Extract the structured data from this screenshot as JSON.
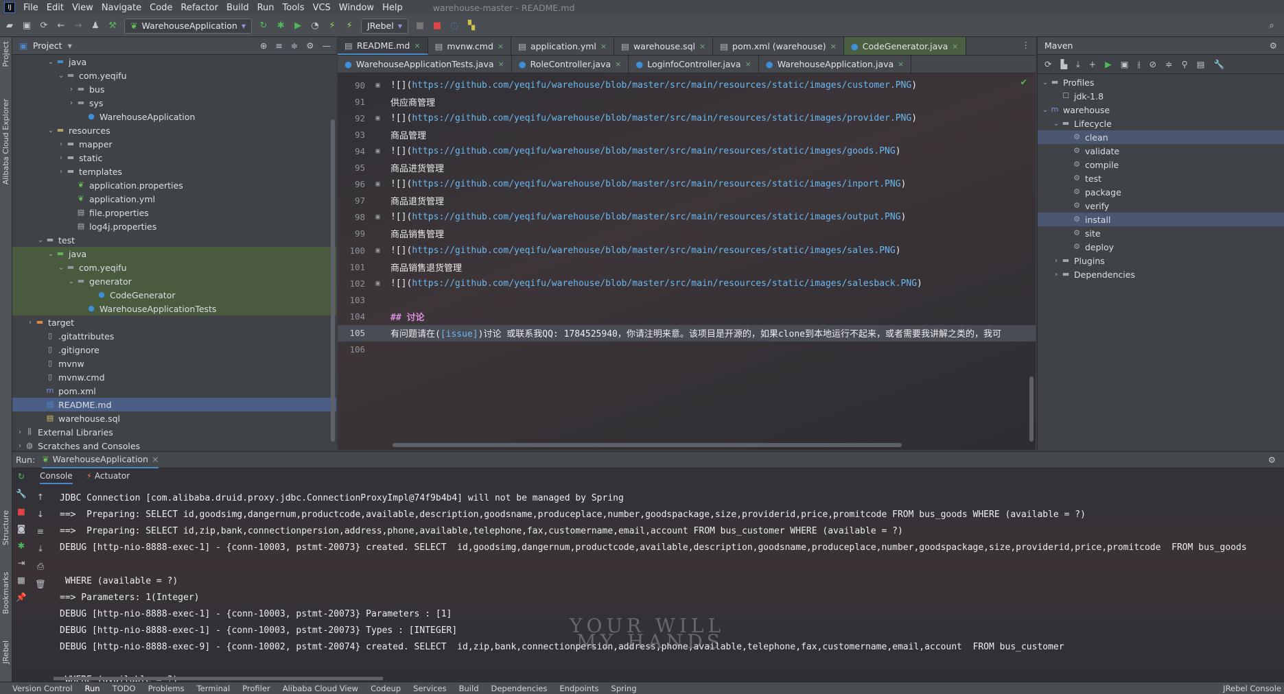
{
  "window": {
    "title": "warehouse-master - README.md"
  },
  "menu": [
    "File",
    "Edit",
    "View",
    "Navigate",
    "Code",
    "Refactor",
    "Build",
    "Run",
    "Tools",
    "VCS",
    "Window",
    "Help"
  ],
  "toolbar": {
    "run_config": "WarehouseApplication",
    "jrebel": "JRebel"
  },
  "project": {
    "title": "Project",
    "tree": [
      {
        "label": "java",
        "indent": 3,
        "chev": "v",
        "icon": "folder-blue"
      },
      {
        "label": "com.yeqifu",
        "indent": 4,
        "chev": "v",
        "icon": "package"
      },
      {
        "label": "bus",
        "indent": 5,
        "chev": ">",
        "icon": "package"
      },
      {
        "label": "sys",
        "indent": 5,
        "chev": ">",
        "icon": "package"
      },
      {
        "label": "WarehouseApplication",
        "indent": 6,
        "chev": "",
        "icon": "class"
      },
      {
        "label": "resources",
        "indent": 3,
        "chev": "v",
        "icon": "folder-res"
      },
      {
        "label": "mapper",
        "indent": 4,
        "chev": ">",
        "icon": "folder"
      },
      {
        "label": "static",
        "indent": 4,
        "chev": ">",
        "icon": "folder"
      },
      {
        "label": "templates",
        "indent": 4,
        "chev": ">",
        "icon": "folder"
      },
      {
        "label": "application.properties",
        "indent": 5,
        "chev": "",
        "icon": "spring"
      },
      {
        "label": "application.yml",
        "indent": 5,
        "chev": "",
        "icon": "spring"
      },
      {
        "label": "file.properties",
        "indent": 5,
        "chev": "",
        "icon": "props"
      },
      {
        "label": "log4j.properties",
        "indent": 5,
        "chev": "",
        "icon": "props"
      },
      {
        "label": "test",
        "indent": 2,
        "chev": "v",
        "icon": "folder"
      },
      {
        "label": "java",
        "indent": 3,
        "chev": "v",
        "icon": "folder-green"
      },
      {
        "label": "com.yeqifu",
        "indent": 4,
        "chev": "v",
        "icon": "package"
      },
      {
        "label": "generator",
        "indent": 5,
        "chev": "v",
        "icon": "package"
      },
      {
        "label": "CodeGenerator",
        "indent": 7,
        "chev": "",
        "icon": "class"
      },
      {
        "label": "WarehouseApplicationTests",
        "indent": 6,
        "chev": "",
        "icon": "class"
      },
      {
        "label": "target",
        "indent": 1,
        "chev": ">",
        "icon": "folder-orange"
      },
      {
        "label": ".gitattributes",
        "indent": 2,
        "chev": "",
        "icon": "file"
      },
      {
        "label": ".gitignore",
        "indent": 2,
        "chev": "",
        "icon": "file"
      },
      {
        "label": "mvnw",
        "indent": 2,
        "chev": "",
        "icon": "file"
      },
      {
        "label": "mvnw.cmd",
        "indent": 2,
        "chev": "",
        "icon": "file"
      },
      {
        "label": "pom.xml",
        "indent": 2,
        "chev": "",
        "icon": "maven"
      },
      {
        "label": "README.md",
        "indent": 2,
        "chev": "",
        "icon": "md"
      },
      {
        "label": "warehouse.sql",
        "indent": 2,
        "chev": "",
        "icon": "sql"
      },
      {
        "label": "External Libraries",
        "indent": 0,
        "chev": ">",
        "icon": "lib"
      },
      {
        "label": "Scratches and Consoles",
        "indent": 0,
        "chev": ">",
        "icon": "scratch"
      }
    ]
  },
  "editor": {
    "tabs_row1": [
      {
        "label": "README.md",
        "active": true
      },
      {
        "label": "mvnw.cmd"
      },
      {
        "label": "application.yml"
      },
      {
        "label": "warehouse.sql"
      },
      {
        "label": "pom.xml (warehouse)"
      },
      {
        "label": "CodeGenerator.java",
        "green": true
      }
    ],
    "tabs_row2": [
      {
        "label": "WarehouseApplicationTests.java"
      },
      {
        "label": "RoleController.java"
      },
      {
        "label": "LoginfoController.java"
      },
      {
        "label": "WarehouseApplication.java"
      }
    ],
    "lines": [
      {
        "n": "90",
        "pre": "![](",
        "link": "https://github.com/yeqifu/warehouse/blob/master/src/main/resources/static/images/customer.PNG",
        "post": ")"
      },
      {
        "n": "91",
        "text": "供应商管理"
      },
      {
        "n": "92",
        "pre": "![](",
        "link": "https://github.com/yeqifu/warehouse/blob/master/src/main/resources/static/images/provider.PNG",
        "post": ")"
      },
      {
        "n": "93",
        "text": "商品管理"
      },
      {
        "n": "94",
        "pre": "![](",
        "link": "https://github.com/yeqifu/warehouse/blob/master/src/main/resources/static/images/goods.PNG",
        "post": ")"
      },
      {
        "n": "95",
        "text": "商品进货管理"
      },
      {
        "n": "96",
        "pre": "![](",
        "link": "https://github.com/yeqifu/warehouse/blob/master/src/main/resources/static/images/inport.PNG",
        "post": ")"
      },
      {
        "n": "97",
        "text": "商品退货管理"
      },
      {
        "n": "98",
        "pre": "![](",
        "link": "https://github.com/yeqifu/warehouse/blob/master/src/main/resources/static/images/output.PNG",
        "post": ")"
      },
      {
        "n": "99",
        "text": "商品销售管理"
      },
      {
        "n": "100",
        "pre": "![](",
        "link": "https://github.com/yeqifu/warehouse/blob/master/src/main/resources/static/images/sales.PNG",
        "post": ")"
      },
      {
        "n": "101",
        "text": "商品销售退货管理"
      },
      {
        "n": "102",
        "pre": "![](",
        "link": "https://github.com/yeqifu/warehouse/blob/master/src/main/resources/static/images/salesback.PNG",
        "post": ")"
      },
      {
        "n": "103",
        "text": ""
      },
      {
        "n": "104",
        "heading": "## 讨论"
      },
      {
        "n": "105",
        "pre": "有问题请在(",
        "link": "[issue]",
        "post": ")讨论 或联系我QQ: 1784525940，你请注明来意。该项目是开源的，如果clone到本地运行不起来，或者需要我讲解之类的，我可",
        "current": true
      },
      {
        "n": "106",
        "text": ""
      }
    ]
  },
  "maven": {
    "title": "Maven",
    "tree": [
      {
        "label": "Profiles",
        "indent": 0,
        "chev": "v",
        "icon": "folder"
      },
      {
        "label": "jdk-1.8",
        "indent": 1,
        "chev": "",
        "icon": "checkbox"
      },
      {
        "label": "warehouse",
        "indent": 0,
        "chev": "v",
        "icon": "maven"
      },
      {
        "label": "Lifecycle",
        "indent": 1,
        "chev": "v",
        "icon": "folder"
      },
      {
        "label": "clean",
        "indent": 2,
        "chev": "",
        "icon": "gear",
        "selected": true
      },
      {
        "label": "validate",
        "indent": 2,
        "chev": "",
        "icon": "gear"
      },
      {
        "label": "compile",
        "indent": 2,
        "chev": "",
        "icon": "gear"
      },
      {
        "label": "test",
        "indent": 2,
        "chev": "",
        "icon": "gear"
      },
      {
        "label": "package",
        "indent": 2,
        "chev": "",
        "icon": "gear"
      },
      {
        "label": "verify",
        "indent": 2,
        "chev": "",
        "icon": "gear"
      },
      {
        "label": "install",
        "indent": 2,
        "chev": "",
        "icon": "gear",
        "selected": true
      },
      {
        "label": "site",
        "indent": 2,
        "chev": "",
        "icon": "gear"
      },
      {
        "label": "deploy",
        "indent": 2,
        "chev": "",
        "icon": "gear"
      },
      {
        "label": "Plugins",
        "indent": 1,
        "chev": ">",
        "icon": "folder"
      },
      {
        "label": "Dependencies",
        "indent": 1,
        "chev": ">",
        "icon": "folder"
      }
    ]
  },
  "run": {
    "label": "Run:",
    "config_tab": "WarehouseApplication",
    "tabs": [
      "Console",
      "Actuator"
    ],
    "console": [
      "JDBC Connection [com.alibaba.druid.proxy.jdbc.ConnectionProxyImpl@74f9b4b4] will not be managed by Spring",
      "==>  Preparing: SELECT id,goodsimg,dangernum,productcode,available,description,goodsname,produceplace,number,goodspackage,size,providerid,price,promitcode FROM bus_goods WHERE (available = ?)",
      "==>  Preparing: SELECT id,zip,bank,connectionpersion,address,phone,available,telephone,fax,customername,email,account FROM bus_customer WHERE (available = ?)",
      "DEBUG [http-nio-8888-exec-1] - {conn-10003, pstmt-20073} created. SELECT  id,goodsimg,dangernum,productcode,available,description,goodsname,produceplace,number,goodspackage,size,providerid,price,promitcode  FROM bus_goods",
      "",
      " WHERE (available = ?)",
      "==> Parameters: 1(Integer)",
      "DEBUG [http-nio-8888-exec-1] - {conn-10003, pstmt-20073} Parameters : [1]",
      "DEBUG [http-nio-8888-exec-1] - {conn-10003, pstmt-20073} Types : [INTEGER]",
      "DEBUG [http-nio-8888-exec-9] - {conn-10002, pstmt-20074} created. SELECT  id,zip,bank,connectionpersion,address,phone,available,telephone,fax,customername,email,account  FROM bus_customer",
      "",
      " WHERE (available = ?)"
    ]
  },
  "watermark": [
    "YOUR WILL",
    "MY HANDS"
  ],
  "side_labels": {
    "left": [
      "Project",
      "Alibaba Cloud Explorer",
      "Structure",
      "Bookmarks",
      "JRebel"
    ]
  },
  "statusbar": [
    "Version Control",
    "Run",
    "TODO",
    "Problems",
    "Terminal",
    "Profiler",
    "Alibaba Cloud View",
    "Codeup",
    "Services",
    "Build",
    "Dependencies",
    "Endpoints",
    "Spring"
  ],
  "statusbar_right": "JRebel Console"
}
